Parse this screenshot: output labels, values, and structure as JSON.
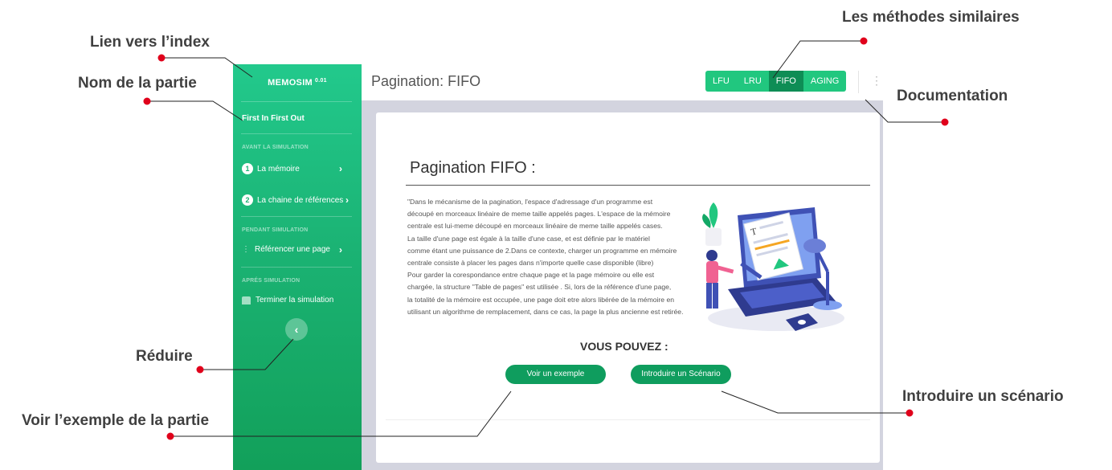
{
  "annotations": {
    "lien_index": "Lien vers l’index",
    "nom_partie": "Nom de la partie",
    "reduire": "Réduire",
    "voir_exemple": "Voir l’exemple de la partie",
    "methodes_similaires": "Les méthodes similaires",
    "documentation": "Documentation",
    "introduire_scenario": "Introduire un scénario"
  },
  "sidebar": {
    "brand": "MEMOSIM",
    "version": "0.01",
    "part_name": "First In First Out",
    "sections": [
      {
        "title": "AVANT LA SIMULATION"
      },
      {
        "title": "PENDANT SIMULATION"
      },
      {
        "title": "APRÉS SIMULATION"
      }
    ],
    "items": [
      {
        "number": "1",
        "label": "La mémoire"
      },
      {
        "number": "2",
        "label": "La chaine de références"
      },
      {
        "label": "Référencer une page"
      },
      {
        "label": "Terminer la simulation"
      }
    ],
    "collapse_icon": "chevron-left-icon"
  },
  "header": {
    "title": "Pagination: FIFO",
    "methods": [
      {
        "label": "LFU",
        "active": false
      },
      {
        "label": "LRU",
        "active": false
      },
      {
        "label": "FIFO",
        "active": true
      },
      {
        "label": "AGING",
        "active": false
      }
    ],
    "doc_icon": "more-vertical-icon"
  },
  "content": {
    "title": "Pagination FIFO :",
    "description_lines": [
      "\"Dans le mécanisme de la pagination, l'espace d'adressage d'un programme est",
      "découpé en morceaux linéaire de meme taille appelés pages. L'espace de la mémoire",
      "centrale est lui-meme découpé en morceaux linéaire de meme taille appelés cases.",
      "La taille d'une page est égale à la taille d'une case, et est définie par le matériel",
      "comme étant une puissance de 2.Dans ce contexte, charger un programme en mémoire",
      "centrale consiste à placer les pages dans n'importe quelle case disponible (libre)",
      "Pour garder la corespondance entre chaque page et la page mémoire ou elle est",
      "chargée, la structure \"Table de pages\" est utilisée . Si, lors de la référence d'une page,",
      "la totalité de la mémoire est occupée, une page doit etre alors libérée de la mémoire en",
      "utilisant un algorithme de remplacement, dans ce cas, la page la plus ancienne est retirée."
    ],
    "vous_pouvez": "VOUS POUVEZ :",
    "example_button": "Voir un exemple",
    "scenario_button": "Introduire un Scénario"
  },
  "colors": {
    "sidebar_green": "#1bb374",
    "method_green": "#21c77f",
    "method_active": "#0e8d55",
    "button_green": "#0f9d5e",
    "annotation_red": "#e0001b"
  }
}
